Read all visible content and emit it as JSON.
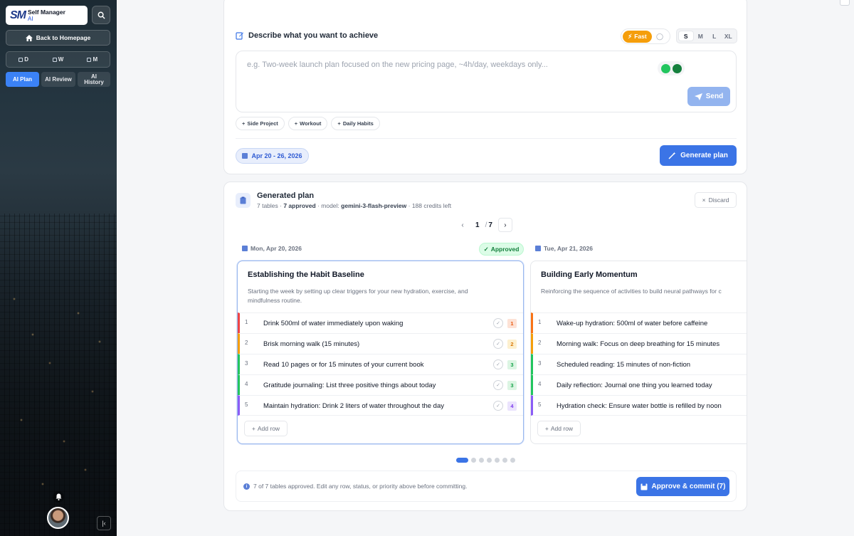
{
  "app": {
    "logo": "SM",
    "name": "Self Manager",
    "sub": "AI"
  },
  "sidebar": {
    "home_label": "Back to Homepage",
    "views": [
      {
        "label": "D"
      },
      {
        "label": "W"
      },
      {
        "label": "M"
      }
    ],
    "ai_tabs": [
      {
        "label": "AI Plan",
        "active": true
      },
      {
        "label": "AI Review"
      },
      {
        "label": "AI History"
      }
    ]
  },
  "composer": {
    "title": "Describe what you want to achieve",
    "mode_label": "Fast",
    "sizes": [
      {
        "label": "S",
        "selected": true
      },
      {
        "label": "M"
      },
      {
        "label": "L"
      },
      {
        "label": "XL"
      }
    ],
    "placeholder": "e.g. Two-week launch plan focused on the new pricing page, ~4h/day, weekdays only...",
    "send_label": "Send",
    "chips": [
      "Side Project",
      "Workout",
      "Daily Habits"
    ],
    "date_range": "Apr 20 - 26, 2026",
    "generate_label": "Generate plan"
  },
  "plan": {
    "title": "Generated plan",
    "tables_count": "7 tables",
    "approved_count": "7 approved",
    "model_label": "model:",
    "model": "gemini-3-flash-preview",
    "credits": "188 credits left",
    "discard_label": "Discard",
    "page_current": "1",
    "page_total": "7",
    "approved_badge": "Approved",
    "days": [
      {
        "date": "Mon, Apr 20, 2026",
        "title": "Establishing the Habit Baseline",
        "desc_line1": "Starting the week by setting up clear triggers for your new hydration, exercise, and",
        "desc_line2": "mindfulness routine.",
        "rows": [
          {
            "n": "1",
            "text": "Drink 500ml of water immediately upon waking",
            "prio": "1"
          },
          {
            "n": "2",
            "text": "Brisk morning walk (15 minutes)",
            "prio": "2"
          },
          {
            "n": "3",
            "text": "Read 10 pages or for 15 minutes of your current book",
            "prio": "3"
          },
          {
            "n": "4",
            "text": "Gratitude journaling: List three positive things about today",
            "prio": "3"
          },
          {
            "n": "5",
            "text": "Maintain hydration: Drink 2 liters of water throughout the day",
            "prio": "4"
          }
        ],
        "add_row": "Add row"
      },
      {
        "date": "Tue, Apr 21, 2026",
        "title": "Building Early Momentum",
        "desc_line1": "Reinforcing the sequence of activities to build neural pathways for c",
        "rows": [
          {
            "n": "1",
            "text": "Wake-up hydration: 500ml of water before caffeine"
          },
          {
            "n": "2",
            "text": "Morning walk: Focus on deep breathing for 15 minutes"
          },
          {
            "n": "3",
            "text": "Scheduled reading: 15 minutes of non-fiction"
          },
          {
            "n": "4",
            "text": "Daily reflection: Journal one thing you learned today"
          },
          {
            "n": "5",
            "text": "Hydration check: Ensure water bottle is refilled by noon"
          }
        ],
        "add_row": "Add row"
      }
    ],
    "footer_text": "7 of 7 tables approved. Edit any row, status, or priority above before committing.",
    "commit_label": "Approve & commit (7)"
  },
  "colors": {
    "accent": "#3b74e6",
    "fast": "#f59e0b",
    "approved": "#15803d",
    "prio1": "#ef4444",
    "prio2": "#f59e0b",
    "prio3": "#22c55e",
    "prio4": "#8b5cf6"
  }
}
